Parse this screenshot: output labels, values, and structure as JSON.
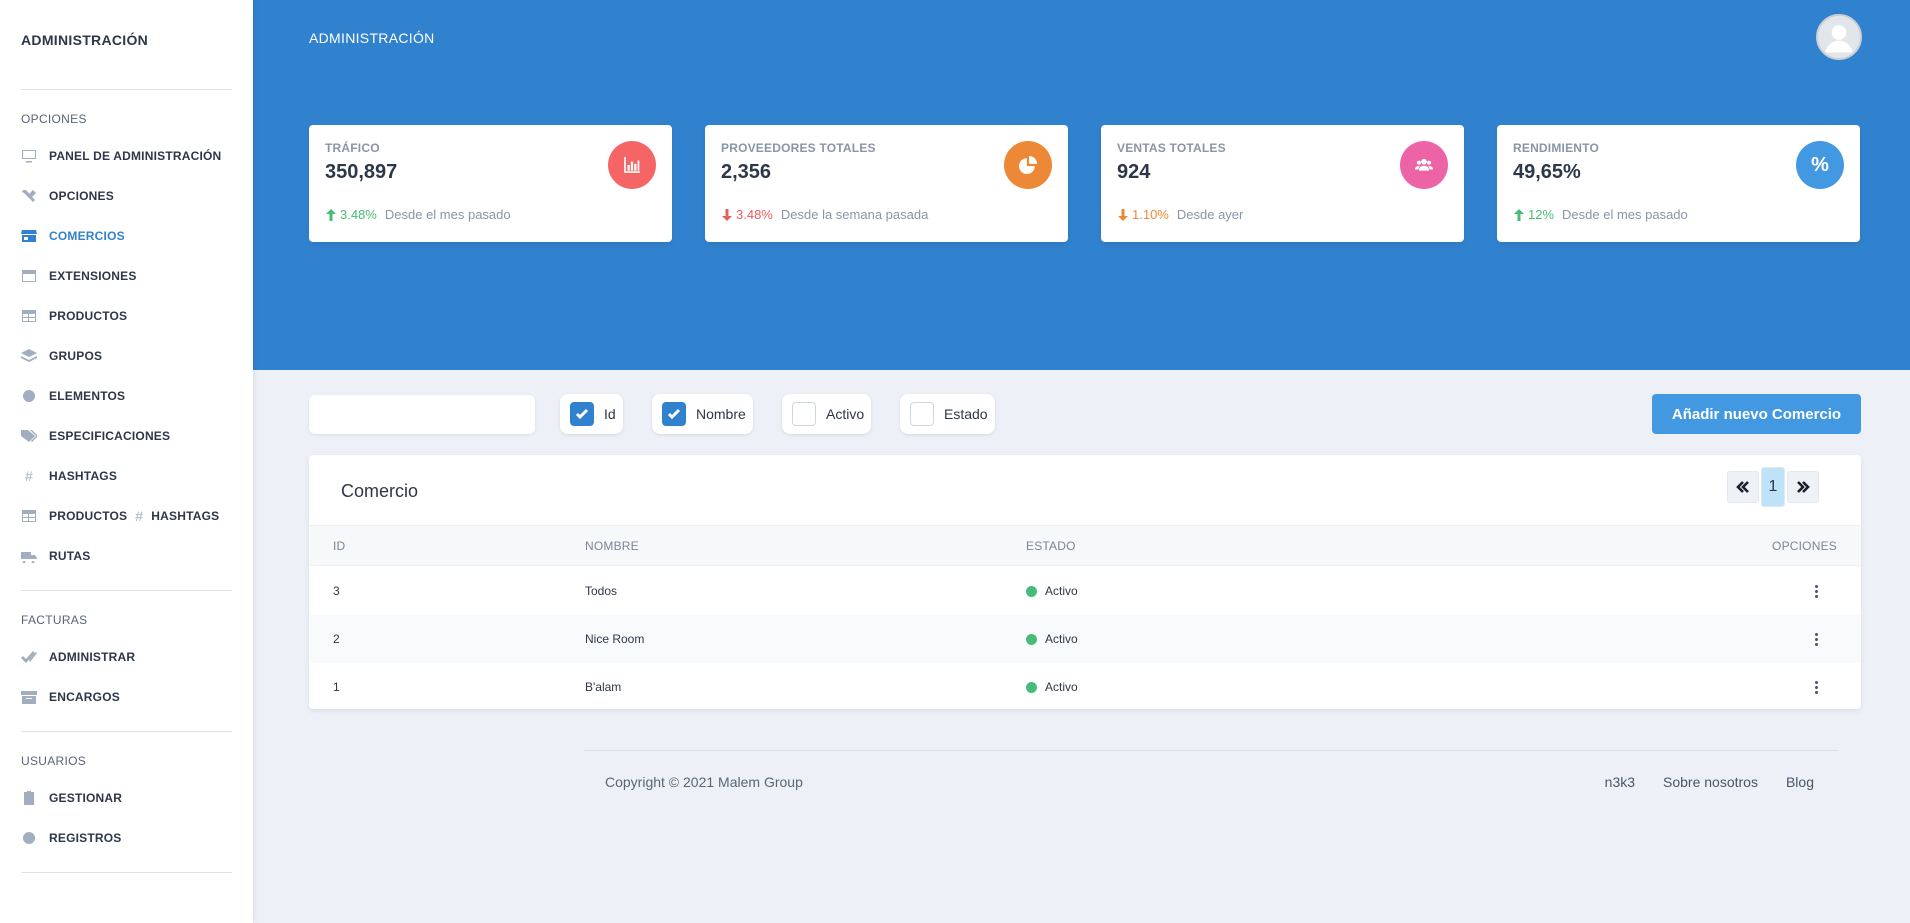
{
  "sidebar": {
    "brand": "ADMINISTRACIÓN",
    "sections": {
      "opciones": "OPCIONES",
      "facturas": "FACTURAS",
      "usuarios": "USUARIOS"
    },
    "items": {
      "panel": "PANEL DE ADMINISTRACIÓN",
      "opciones": "OPCIONES",
      "comercios": "COMERCIOS",
      "extensiones": "EXTENSIONES",
      "productos": "PRODUCTOS",
      "grupos": "GRUPOS",
      "elementos": "ELEMENTOS",
      "especificaciones": "ESPECIFICACIONES",
      "hashtags": "HASHTAGS",
      "productos_hashtags_a": "PRODUCTOS",
      "productos_hashtags_b": "HASHTAGS",
      "rutas": "RUTAS",
      "administrar": "ADMINISTRAR",
      "encargos": "ENCARGOS",
      "gestionar": "GESTIONAR",
      "registros": "REGISTROS"
    },
    "active_item": "COMERCIOS",
    "hash_glyph": "#"
  },
  "header": {
    "title": "ADMINISTRACIÓN"
  },
  "stats": [
    {
      "label": "TRÁFICO",
      "value": "350,897",
      "delta": "3.48%",
      "direction": "up",
      "note": "Desde el mes pasado",
      "icon": "bar-chart-icon",
      "color": "#f56565"
    },
    {
      "label": "PROVEEDORES TOTALES",
      "value": "2,356",
      "delta": "3.48%",
      "direction": "down",
      "note": "Desde la semana pasada",
      "icon": "pie-chart-icon",
      "color": "#ed8936"
    },
    {
      "label": "VENTAS TOTALES",
      "value": "924",
      "delta": "1.10%",
      "direction": "down",
      "note": "Desde ayer",
      "icon": "users-icon",
      "color": "#ed64a6"
    },
    {
      "label": "RENDIMIENTO",
      "value": "49,65%",
      "delta": "12%",
      "direction": "up",
      "note": "Desde el mes pasado",
      "icon": "percent-icon",
      "icon_text": "%",
      "color": "#4299e1"
    }
  ],
  "filters": {
    "search_value": "",
    "columns": [
      {
        "label": "Id",
        "checked": true
      },
      {
        "label": "Nombre",
        "checked": true
      },
      {
        "label": "Activo",
        "checked": false
      },
      {
        "label": "Estado",
        "checked": false
      }
    ],
    "add_button": "Añadir nuevo Comercio"
  },
  "table": {
    "title": "Comercio",
    "pager": {
      "current_page": "1"
    },
    "headers": {
      "id": "ID",
      "name": "NOMBRE",
      "state": "ESTADO",
      "options": "OPCIONES"
    },
    "rows": [
      {
        "id": "3",
        "name": "Todos",
        "state": "Activo"
      },
      {
        "id": "2",
        "name": "Nice Room",
        "state": "Activo"
      },
      {
        "id": "1",
        "name": "B'alam",
        "state": "Activo"
      }
    ]
  },
  "footer": {
    "copyright": "Copyright © 2021 Malem Group",
    "links": [
      "n3k3",
      "Sobre nosotros",
      "Blog"
    ]
  }
}
